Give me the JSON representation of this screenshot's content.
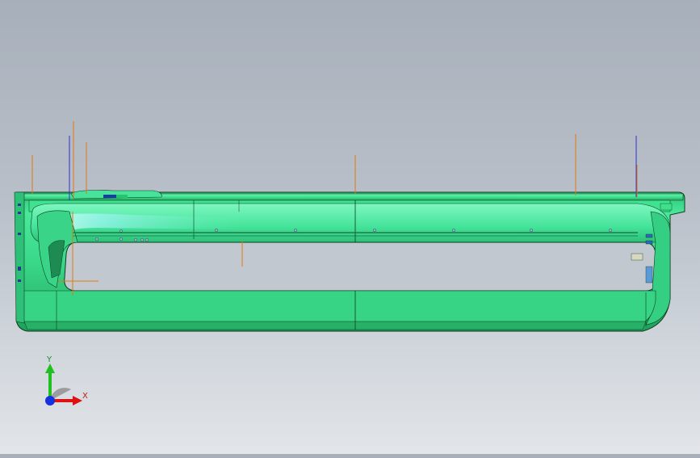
{
  "viewport": {
    "background_top": "#a7afba",
    "background_bottom": "#e2e5e9",
    "model": {
      "part_color": "#3fe08a",
      "part_shadow": "#2bb86a",
      "edge_color": "#0d3d1c",
      "reference_line_colors": [
        "#e07a10",
        "#3030d0"
      ]
    }
  },
  "triad": {
    "x_label": "X",
    "y_label": "Y",
    "x_color": "#e01010",
    "y_color": "#20c020",
    "z_color": "#1530e0"
  }
}
